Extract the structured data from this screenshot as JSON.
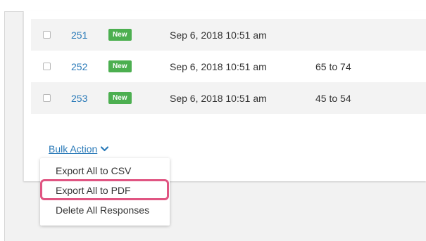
{
  "responses": [
    {
      "id": "251",
      "badge": "New",
      "date": "Sep 6, 2018 10:51 am",
      "age": ""
    },
    {
      "id": "252",
      "badge": "New",
      "date": "Sep 6, 2018 10:51 am",
      "age": "65 to 74"
    },
    {
      "id": "253",
      "badge": "New",
      "date": "Sep 6, 2018 10:51 am",
      "age": "45 to 54"
    }
  ],
  "bulk_action": {
    "label": "Bulk Action",
    "icon": "chevron-down-icon"
  },
  "menu": {
    "items": [
      {
        "label": "Export All to CSV"
      },
      {
        "label": "Export All to PDF",
        "highlighted": true
      },
      {
        "label": "Delete All Responses"
      }
    ]
  },
  "colors": {
    "link": "#2a7ab8",
    "badge": "#4caf50",
    "highlight": "#e05582"
  }
}
